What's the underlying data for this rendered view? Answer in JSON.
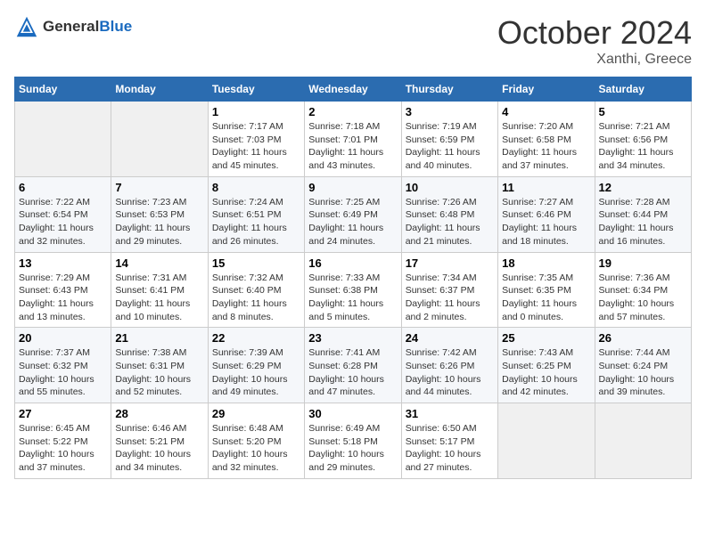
{
  "header": {
    "logo_general": "General",
    "logo_blue": "Blue",
    "month": "October 2024",
    "location": "Xanthi, Greece"
  },
  "weekdays": [
    "Sunday",
    "Monday",
    "Tuesday",
    "Wednesday",
    "Thursday",
    "Friday",
    "Saturday"
  ],
  "weeks": [
    [
      {
        "day": "",
        "info": ""
      },
      {
        "day": "",
        "info": ""
      },
      {
        "day": "1",
        "info": "Sunrise: 7:17 AM\nSunset: 7:03 PM\nDaylight: 11 hours and 45 minutes."
      },
      {
        "day": "2",
        "info": "Sunrise: 7:18 AM\nSunset: 7:01 PM\nDaylight: 11 hours and 43 minutes."
      },
      {
        "day": "3",
        "info": "Sunrise: 7:19 AM\nSunset: 6:59 PM\nDaylight: 11 hours and 40 minutes."
      },
      {
        "day": "4",
        "info": "Sunrise: 7:20 AM\nSunset: 6:58 PM\nDaylight: 11 hours and 37 minutes."
      },
      {
        "day": "5",
        "info": "Sunrise: 7:21 AM\nSunset: 6:56 PM\nDaylight: 11 hours and 34 minutes."
      }
    ],
    [
      {
        "day": "6",
        "info": "Sunrise: 7:22 AM\nSunset: 6:54 PM\nDaylight: 11 hours and 32 minutes."
      },
      {
        "day": "7",
        "info": "Sunrise: 7:23 AM\nSunset: 6:53 PM\nDaylight: 11 hours and 29 minutes."
      },
      {
        "day": "8",
        "info": "Sunrise: 7:24 AM\nSunset: 6:51 PM\nDaylight: 11 hours and 26 minutes."
      },
      {
        "day": "9",
        "info": "Sunrise: 7:25 AM\nSunset: 6:49 PM\nDaylight: 11 hours and 24 minutes."
      },
      {
        "day": "10",
        "info": "Sunrise: 7:26 AM\nSunset: 6:48 PM\nDaylight: 11 hours and 21 minutes."
      },
      {
        "day": "11",
        "info": "Sunrise: 7:27 AM\nSunset: 6:46 PM\nDaylight: 11 hours and 18 minutes."
      },
      {
        "day": "12",
        "info": "Sunrise: 7:28 AM\nSunset: 6:44 PM\nDaylight: 11 hours and 16 minutes."
      }
    ],
    [
      {
        "day": "13",
        "info": "Sunrise: 7:29 AM\nSunset: 6:43 PM\nDaylight: 11 hours and 13 minutes."
      },
      {
        "day": "14",
        "info": "Sunrise: 7:31 AM\nSunset: 6:41 PM\nDaylight: 11 hours and 10 minutes."
      },
      {
        "day": "15",
        "info": "Sunrise: 7:32 AM\nSunset: 6:40 PM\nDaylight: 11 hours and 8 minutes."
      },
      {
        "day": "16",
        "info": "Sunrise: 7:33 AM\nSunset: 6:38 PM\nDaylight: 11 hours and 5 minutes."
      },
      {
        "day": "17",
        "info": "Sunrise: 7:34 AM\nSunset: 6:37 PM\nDaylight: 11 hours and 2 minutes."
      },
      {
        "day": "18",
        "info": "Sunrise: 7:35 AM\nSunset: 6:35 PM\nDaylight: 11 hours and 0 minutes."
      },
      {
        "day": "19",
        "info": "Sunrise: 7:36 AM\nSunset: 6:34 PM\nDaylight: 10 hours and 57 minutes."
      }
    ],
    [
      {
        "day": "20",
        "info": "Sunrise: 7:37 AM\nSunset: 6:32 PM\nDaylight: 10 hours and 55 minutes."
      },
      {
        "day": "21",
        "info": "Sunrise: 7:38 AM\nSunset: 6:31 PM\nDaylight: 10 hours and 52 minutes."
      },
      {
        "day": "22",
        "info": "Sunrise: 7:39 AM\nSunset: 6:29 PM\nDaylight: 10 hours and 49 minutes."
      },
      {
        "day": "23",
        "info": "Sunrise: 7:41 AM\nSunset: 6:28 PM\nDaylight: 10 hours and 47 minutes."
      },
      {
        "day": "24",
        "info": "Sunrise: 7:42 AM\nSunset: 6:26 PM\nDaylight: 10 hours and 44 minutes."
      },
      {
        "day": "25",
        "info": "Sunrise: 7:43 AM\nSunset: 6:25 PM\nDaylight: 10 hours and 42 minutes."
      },
      {
        "day": "26",
        "info": "Sunrise: 7:44 AM\nSunset: 6:24 PM\nDaylight: 10 hours and 39 minutes."
      }
    ],
    [
      {
        "day": "27",
        "info": "Sunrise: 6:45 AM\nSunset: 5:22 PM\nDaylight: 10 hours and 37 minutes."
      },
      {
        "day": "28",
        "info": "Sunrise: 6:46 AM\nSunset: 5:21 PM\nDaylight: 10 hours and 34 minutes."
      },
      {
        "day": "29",
        "info": "Sunrise: 6:48 AM\nSunset: 5:20 PM\nDaylight: 10 hours and 32 minutes."
      },
      {
        "day": "30",
        "info": "Sunrise: 6:49 AM\nSunset: 5:18 PM\nDaylight: 10 hours and 29 minutes."
      },
      {
        "day": "31",
        "info": "Sunrise: 6:50 AM\nSunset: 5:17 PM\nDaylight: 10 hours and 27 minutes."
      },
      {
        "day": "",
        "info": ""
      },
      {
        "day": "",
        "info": ""
      }
    ]
  ]
}
